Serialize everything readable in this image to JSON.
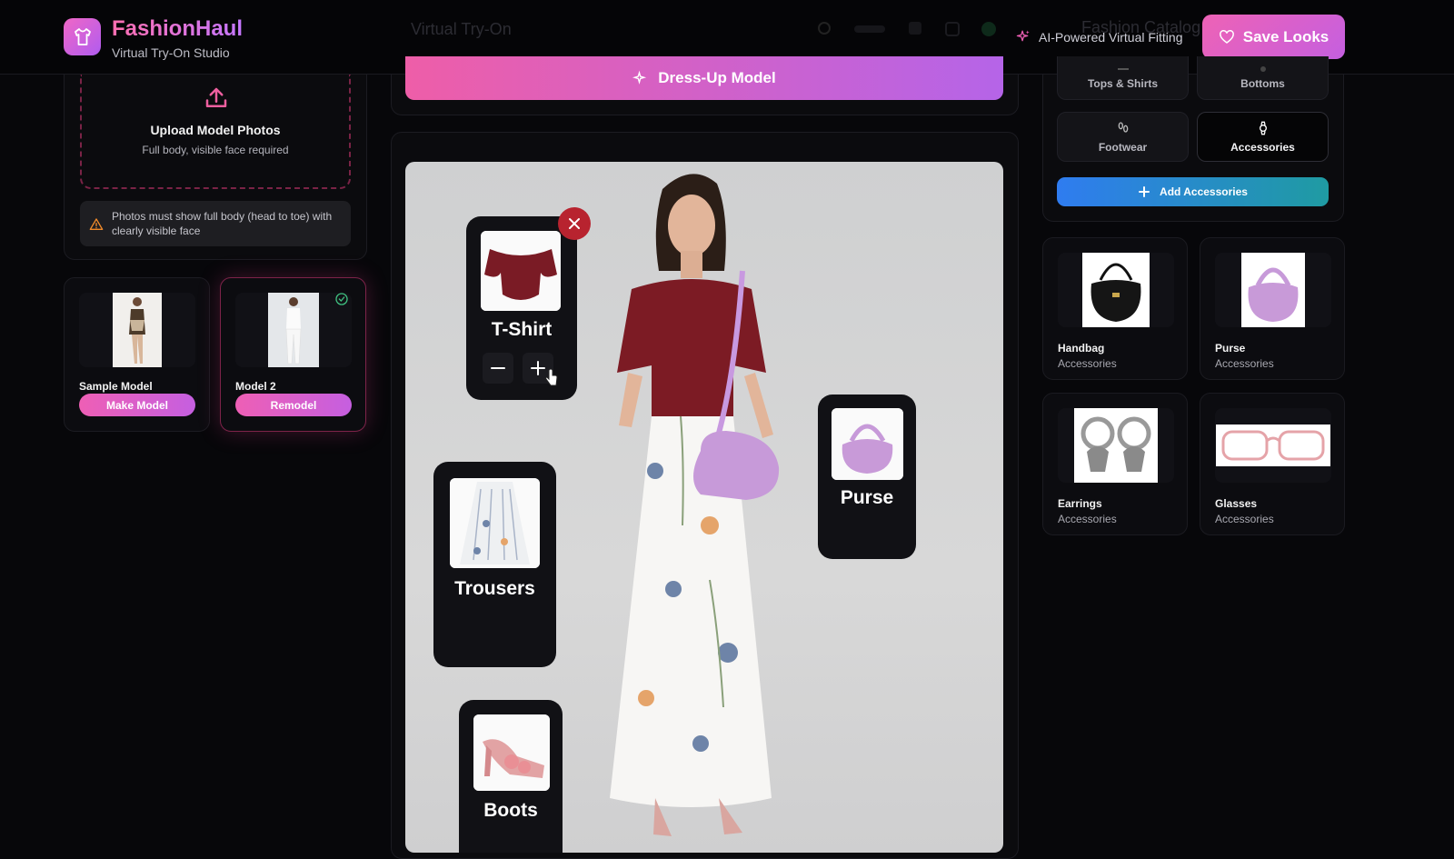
{
  "header": {
    "brand": "FashionHaul",
    "subtitle": "Virtual Try-On Studio",
    "ghost_tab": "Virtual Try-On",
    "ghost_right": "Fashion Catalog",
    "ai_tag": "AI-Powered Virtual Fitting",
    "save_label": "Save Looks"
  },
  "upload": {
    "title": "Upload Model Photos",
    "subtitle": "Full body, visible face required",
    "warning": "Photos must show full body (head to toe) with clearly visible face"
  },
  "models": [
    {
      "name": "Sample Model",
      "action": "Make Model",
      "selected": false
    },
    {
      "name": "Model 2",
      "action": "Remodel",
      "selected": true
    }
  ],
  "center": {
    "dress_button": "Dress-Up Model",
    "garments": [
      {
        "label": "T-Shirt"
      },
      {
        "label": "Trousers"
      },
      {
        "label": "Purse"
      },
      {
        "label": "Boots"
      }
    ]
  },
  "catalog": {
    "categories": [
      {
        "label": "Tops & Shirts",
        "icon": "shirt-icon",
        "active": false
      },
      {
        "label": "Bottoms",
        "icon": "trousers-icon",
        "active": false
      },
      {
        "label": "Footwear",
        "icon": "footprints-icon",
        "active": false
      },
      {
        "label": "Accessories",
        "icon": "watch-icon",
        "active": true
      }
    ],
    "add_button": "Add Accessories",
    "items": [
      {
        "name": "Handbag",
        "category": "Accessories"
      },
      {
        "name": "Purse",
        "category": "Accessories"
      },
      {
        "name": "Earrings",
        "category": "Accessories"
      },
      {
        "name": "Glasses",
        "category": "Accessories"
      }
    ]
  },
  "colors": {
    "accent_pink": "#ee5fb5",
    "accent_purple": "#c55fe0",
    "accent_blue": "#2f7cf0",
    "success_green": "#3fbf7f"
  }
}
